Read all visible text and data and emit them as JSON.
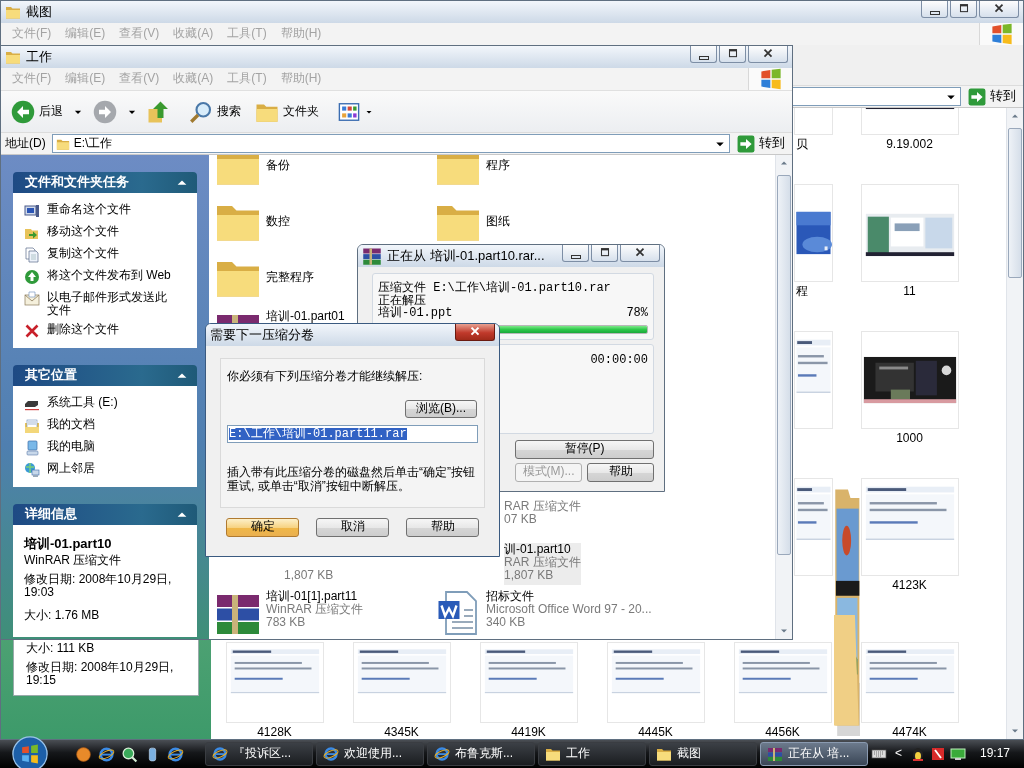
{
  "back_window": {
    "title": "截图",
    "menu": [
      "文件(F)",
      "编辑(E)",
      "查看(V)",
      "收藏(A)",
      "工具(T)",
      "帮助(H)"
    ],
    "go_button": "转到",
    "details": [
      "大小: 111 KB",
      "修改日期: 2008年10月29日, 19:15"
    ],
    "thumbnails": [
      {
        "kind": "picture",
        "label": "贝"
      },
      {
        "kind": "picture",
        "label": "9.19.002"
      },
      {
        "kind": "picture",
        "label": "程"
      },
      {
        "kind": "picture",
        "label": "11"
      },
      {
        "kind": "picture"
      },
      {
        "kind": "picture",
        "label": "1000"
      },
      {
        "kind": "picture"
      },
      {
        "kind": "picture",
        "label": "4123K"
      },
      {
        "kind": "picture",
        "label": "4128K"
      },
      {
        "kind": "picture",
        "label": "4345K"
      },
      {
        "kind": "picture",
        "label": "4419K"
      },
      {
        "kind": "picture",
        "label": "4445K"
      },
      {
        "kind": "picture",
        "label": "4456K"
      },
      {
        "kind": "picture",
        "label": "4474K"
      }
    ]
  },
  "work_window": {
    "title": "工作",
    "menu": [
      "文件(F)",
      "编辑(E)",
      "查看(V)",
      "收藏(A)",
      "工具(T)",
      "帮助(H)"
    ],
    "toolbar": {
      "back": "后退",
      "search": "搜索",
      "folders": "文件夹"
    },
    "address": {
      "label": "地址(D)",
      "value": "E:\\工作",
      "go": "转到"
    },
    "task_panels": [
      {
        "kind": "tasks",
        "title": "文件和文件夹任务",
        "expanded": true,
        "items": [
          "重命名这个文件",
          "移动这个文件",
          "复制这个文件",
          "将这个文件发布到 Web",
          "以电子邮件形式发送此文件",
          "删除这个文件"
        ]
      },
      {
        "kind": "places",
        "title": "其它位置",
        "expanded": true,
        "items": [
          "系统工具 (E:)",
          "我的文档",
          "我的电脑",
          "网上邻居"
        ]
      },
      {
        "kind": "details",
        "title": "详细信息",
        "expanded": true,
        "details": {
          "name": "培训-01.part10",
          "type": "WinRAR 压缩文件",
          "modified": "修改日期: 2008年10月29日, 19:03",
          "size": "大小: 1.76 MB"
        }
      }
    ],
    "files": [
      {
        "kind": "folder",
        "name": "备份",
        "selected": false
      },
      {
        "kind": "folder",
        "name": "程序",
        "selected": false
      },
      {
        "kind": "folder",
        "name": "数控",
        "selected": false
      },
      {
        "kind": "folder",
        "name": "图纸",
        "selected": false
      },
      {
        "kind": "folder",
        "name": "完整程序",
        "selected": false
      },
      {
        "kind": "archive",
        "name": "培训-01.part01",
        "selected": false
      },
      {
        "kind": "partial",
        "lines": [
          "RAR 压缩文件",
          "07 KB"
        ],
        "selected": false
      },
      {
        "kind": "partial",
        "lines": [
          "1,807 KB"
        ],
        "selected": false
      },
      {
        "kind": "partial",
        "lines": [
          "训-01.part10",
          "RAR 压缩文件",
          "1,807 KB"
        ],
        "selected": true
      },
      {
        "kind": "archive",
        "name": "培训-01[1].part11",
        "type": "WinRAR 压缩文件",
        "size": "783 KB",
        "selected": false
      },
      {
        "kind": "document",
        "name": "招标文件",
        "type": "Microsoft Office Word 97 - 20...",
        "size": "340 KB",
        "selected": false
      }
    ]
  },
  "progress_window": {
    "title": "正在从 培训-01.part10.rar...",
    "archive_line": "压缩文件 E:\\工作\\培训-01.part10.rar",
    "status": "正在解压",
    "file": "培训-01.ppt",
    "percent": "78%",
    "level": 1,
    "elapsed": "00:00:00",
    "buttons": [
      {
        "label": "暂停(P)",
        "disabled": false
      },
      {
        "label": "模式(M)...",
        "disabled": true
      },
      {
        "label": "帮助",
        "disabled": false
      }
    ]
  },
  "volume_dialog": {
    "title": "需要下一压缩分卷",
    "message": "你必须有下列压缩分卷才能继续解压:",
    "browse": "浏览(B)...",
    "path": "E:\\工作\\培训-01.part11.rar",
    "path_highlighted": true,
    "hint": "插入带有此压缩分卷的磁盘然后单击“确定”按钮重试, 或单击“取消”按钮中断解压。",
    "buttons": [
      {
        "label": "确定",
        "default": true
      },
      {
        "label": "取消",
        "default": false
      },
      {
        "label": "帮助",
        "default": false
      }
    ]
  },
  "taskbar": {
    "tasks": [
      {
        "label": "『投诉区...",
        "selected": false
      },
      {
        "label": "欢迎使用...",
        "selected": false
      },
      {
        "label": "布鲁克斯...",
        "selected": false
      },
      {
        "label": "工作",
        "selected": false
      },
      {
        "label": "截图",
        "selected": false
      },
      {
        "label": "正在从 培...",
        "selected": true
      }
    ],
    "tray_arrow": "<",
    "clock": "19:17"
  }
}
